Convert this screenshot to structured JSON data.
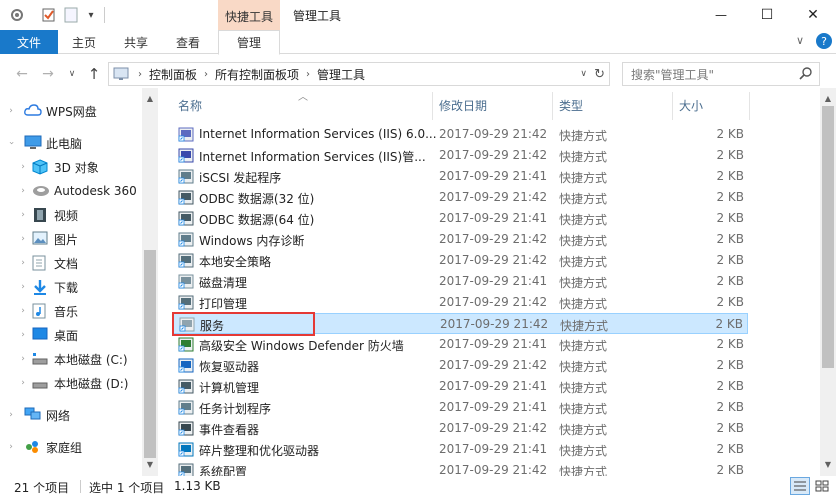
{
  "window": {
    "title": "管理工具",
    "context_tab": "快捷工具",
    "minimize": "—",
    "maximize": "☐",
    "close": "✕"
  },
  "ribbon": {
    "file": "文件",
    "tabs": [
      "主页",
      "共享",
      "查看",
      "管理"
    ],
    "collapse": "∨",
    "help": "?"
  },
  "address": {
    "crumbs": [
      "控制面板",
      "所有控制面板项",
      "管理工具"
    ],
    "search_placeholder": "搜索\"管理工具\""
  },
  "nav": {
    "items": [
      {
        "label": "WPS网盘",
        "icon": "cloud-icon"
      },
      {
        "label": "此电脑",
        "icon": "computer-icon"
      },
      {
        "label": "3D 对象",
        "icon": "cube-icon"
      },
      {
        "label": "Autodesk 360",
        "icon": "autodesk-icon"
      },
      {
        "label": "视频",
        "icon": "video-icon"
      },
      {
        "label": "图片",
        "icon": "picture-icon"
      },
      {
        "label": "文档",
        "icon": "document-icon"
      },
      {
        "label": "下载",
        "icon": "download-icon"
      },
      {
        "label": "音乐",
        "icon": "music-icon"
      },
      {
        "label": "桌面",
        "icon": "desktop-icon"
      },
      {
        "label": "本地磁盘 (C:)",
        "icon": "drive-icon"
      },
      {
        "label": "本地磁盘 (D:)",
        "icon": "drive-icon"
      },
      {
        "label": "网络",
        "icon": "network-icon"
      },
      {
        "label": "家庭组",
        "icon": "homegroup-icon"
      }
    ]
  },
  "columns": {
    "name": "名称",
    "date": "修改日期",
    "type": "类型",
    "size": "大小"
  },
  "files": [
    {
      "name": "Internet Information Services (IIS) 6.0...",
      "date": "2017-09-29 21:42",
      "type": "快捷方式",
      "size": "2 KB"
    },
    {
      "name": "Internet Information Services (IIS)管...",
      "date": "2017-09-29 21:42",
      "type": "快捷方式",
      "size": "2 KB"
    },
    {
      "name": "iSCSI 发起程序",
      "date": "2017-09-29 21:41",
      "type": "快捷方式",
      "size": "2 KB"
    },
    {
      "name": "ODBC 数据源(32 位)",
      "date": "2017-09-29 21:42",
      "type": "快捷方式",
      "size": "2 KB"
    },
    {
      "name": "ODBC 数据源(64 位)",
      "date": "2017-09-29 21:41",
      "type": "快捷方式",
      "size": "2 KB"
    },
    {
      "name": "Windows 内存诊断",
      "date": "2017-09-29 21:42",
      "type": "快捷方式",
      "size": "2 KB"
    },
    {
      "name": "本地安全策略",
      "date": "2017-09-29 21:42",
      "type": "快捷方式",
      "size": "2 KB"
    },
    {
      "name": "磁盘清理",
      "date": "2017-09-29 21:41",
      "type": "快捷方式",
      "size": "2 KB"
    },
    {
      "name": "打印管理",
      "date": "2017-09-29 21:42",
      "type": "快捷方式",
      "size": "2 KB"
    },
    {
      "name": "服务",
      "date": "2017-09-29 21:42",
      "type": "快捷方式",
      "size": "2 KB"
    },
    {
      "name": "高级安全 Windows Defender 防火墙",
      "date": "2017-09-29 21:41",
      "type": "快捷方式",
      "size": "2 KB"
    },
    {
      "name": "恢复驱动器",
      "date": "2017-09-29 21:42",
      "type": "快捷方式",
      "size": "2 KB"
    },
    {
      "name": "计算机管理",
      "date": "2017-09-29 21:41",
      "type": "快捷方式",
      "size": "2 KB"
    },
    {
      "name": "任务计划程序",
      "date": "2017-09-29 21:41",
      "type": "快捷方式",
      "size": "2 KB"
    },
    {
      "name": "事件查看器",
      "date": "2017-09-29 21:42",
      "type": "快捷方式",
      "size": "2 KB"
    },
    {
      "name": "碎片整理和优化驱动器",
      "date": "2017-09-29 21:41",
      "type": "快捷方式",
      "size": "2 KB"
    },
    {
      "name": "系统配置",
      "date": "2017-09-29 21:42",
      "type": "快捷方式",
      "size": "2 KB"
    }
  ],
  "selected_index": 9,
  "status": {
    "count": "21 个项目",
    "selection": "选中 1 个项目",
    "size": "1.13 KB"
  },
  "colors": {
    "accent": "#1979ca",
    "context_tab": "#f9d9c6",
    "selection": "#cce8ff",
    "highlight_box": "#e53935"
  }
}
